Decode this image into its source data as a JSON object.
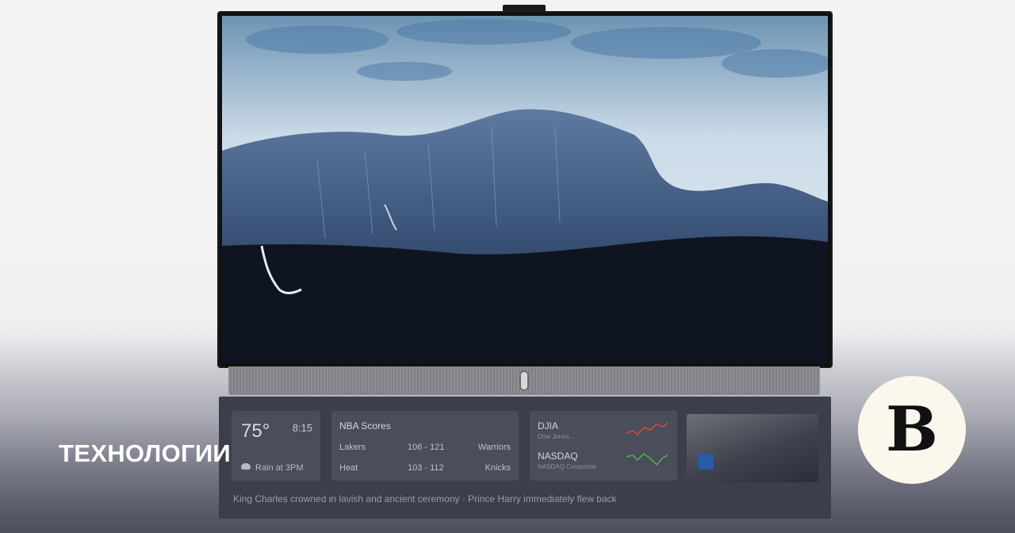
{
  "section_label": "ТЕХНОЛОГИИ",
  "brand_logo_letter": "В",
  "dashboard": {
    "weather": {
      "temp": "75°",
      "time": "8:15",
      "forecast": "Rain at 3PM"
    },
    "nba": {
      "title": "NBA Scores",
      "games": [
        {
          "team_a": "Lakers",
          "score": "106 - 121",
          "team_b": "Warriors"
        },
        {
          "team_a": "Heat",
          "score": "103 - 112",
          "team_b": "Knicks"
        }
      ]
    },
    "stocks": [
      {
        "name": "DJIA",
        "sub": "Dow Jones...",
        "trend_color": "#d2493f"
      },
      {
        "name": "NASDAQ",
        "sub": "NASDAQ Composite",
        "trend_color": "#4cae4f"
      }
    ],
    "ticker": "King Charles crowned in lavish and ancient ceremony · Prince Harry immediately flew back"
  },
  "colors": {
    "dashboard_bg": "#3c3f4b",
    "card_bg": "#4a4d5a",
    "logo_bg": "#fbf7ec"
  }
}
